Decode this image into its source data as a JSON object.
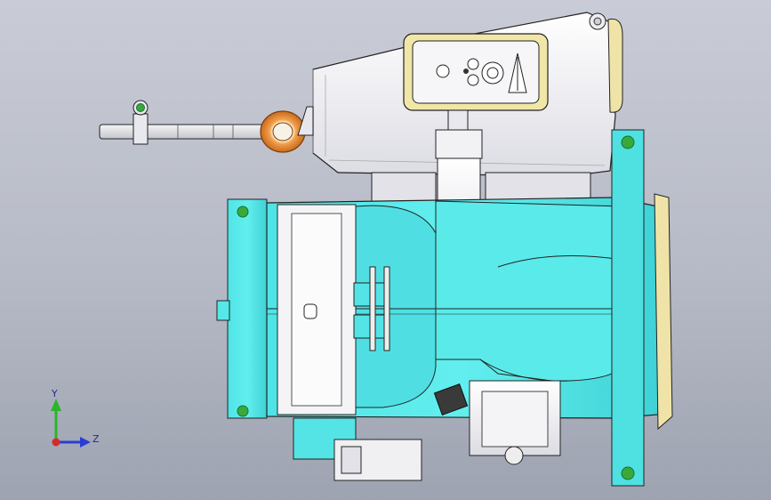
{
  "scene": {
    "description_label": "",
    "background_top": "#c9ccd6",
    "background_bottom": "#9ea3b1"
  },
  "triad": {
    "y_label": "Y",
    "z_label": "Z",
    "y_color": "#2bb52b",
    "z_color": "#2b3cd6",
    "origin_color": "#d62b2b"
  },
  "colors": {
    "housing_white": "#eeeef2",
    "cyan_body": "#56e8e8",
    "cyan_dark": "#35c9cc",
    "cream_cap": "#efe3a8",
    "orange_ring": "#e88a3a",
    "green_bolt": "#3aa83a",
    "outline": "#1a1a1a"
  },
  "icons": {
    "y_axis": "arrow-up-icon",
    "z_axis": "arrow-right-icon"
  }
}
